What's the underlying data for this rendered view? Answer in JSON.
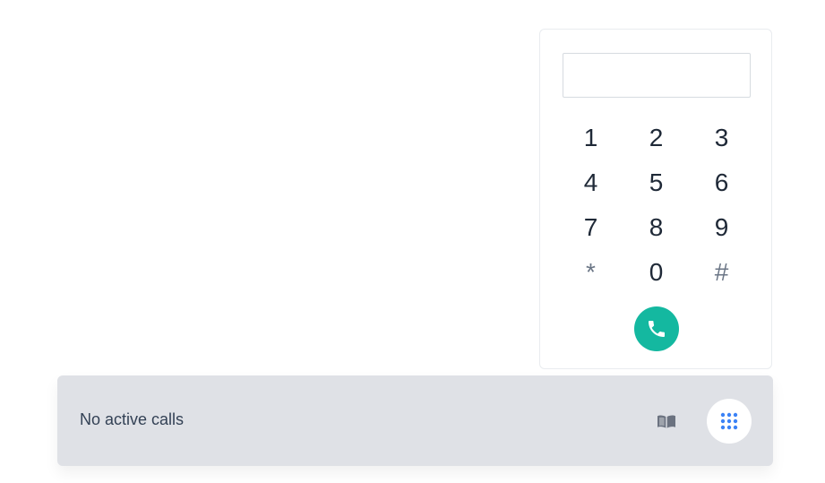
{
  "dialpad": {
    "input_value": "",
    "input_placeholder": "",
    "keys": [
      {
        "label": "1"
      },
      {
        "label": "2"
      },
      {
        "label": "3"
      },
      {
        "label": "4"
      },
      {
        "label": "5"
      },
      {
        "label": "6"
      },
      {
        "label": "7"
      },
      {
        "label": "8"
      },
      {
        "label": "9"
      },
      {
        "label": "*"
      },
      {
        "label": "0"
      },
      {
        "label": "#"
      }
    ],
    "call_button_icon": "phone-icon",
    "call_button_color": "#14b8a0"
  },
  "status_bar": {
    "status_text": "No active calls",
    "contacts_icon": "book-icon",
    "dialpad_toggle_icon": "dialpad-grid-icon",
    "accent_color": "#3b82f6",
    "background_color": "#dfe1e6"
  }
}
